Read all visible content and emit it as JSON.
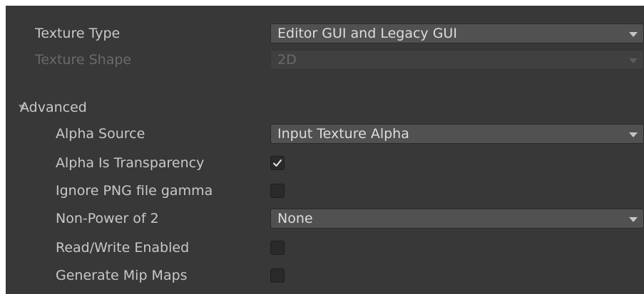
{
  "texture_type": {
    "label": "Texture Type",
    "value": "Editor GUI and Legacy GUI"
  },
  "texture_shape": {
    "label": "Texture Shape",
    "value": "2D",
    "disabled": true
  },
  "advanced": {
    "label": "Advanced",
    "expanded": true,
    "alpha_source": {
      "label": "Alpha Source",
      "value": "Input Texture Alpha"
    },
    "alpha_is_transparency": {
      "label": "Alpha Is Transparency",
      "checked": true
    },
    "ignore_png_gamma": {
      "label": "Ignore PNG file gamma",
      "checked": false
    },
    "non_power_of_2": {
      "label": "Non-Power of 2",
      "value": "None"
    },
    "read_write_enabled": {
      "label": "Read/Write Enabled",
      "checked": false
    },
    "generate_mip_maps": {
      "label": "Generate Mip Maps",
      "checked": false
    }
  },
  "icons": {
    "dropdown_arrow": "chevron-down-icon",
    "foldout_arrow": "foldout-expanded-icon",
    "checkmark": "checkmark-icon"
  },
  "colors": {
    "panel_background": "#383838",
    "field_background": "#515151",
    "checkbox_background": "#2a2a2a",
    "label_text": "#c8c8c8",
    "disabled_text": "#6a6a6a"
  }
}
